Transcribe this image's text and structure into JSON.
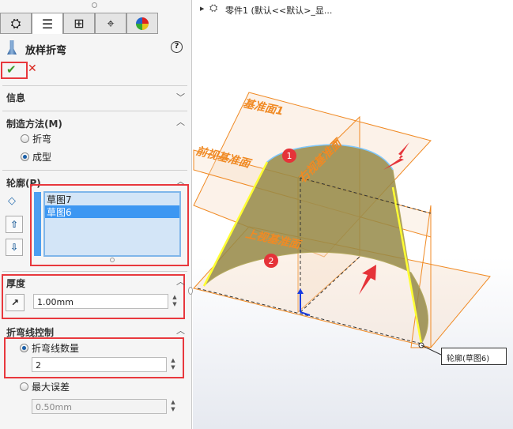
{
  "panel": {
    "tabs": [
      {
        "icon": "part-icon"
      },
      {
        "icon": "property-manager-icon"
      },
      {
        "icon": "config-manager-icon"
      },
      {
        "icon": "dimxpert-icon"
      },
      {
        "icon": "appearance-icon"
      }
    ],
    "title": "放样折弯",
    "help": "?",
    "ok": "✔",
    "cancel": "✕",
    "sections": {
      "info": "信息",
      "method": {
        "title": "制造方法(M)",
        "options": [
          "折弯",
          "成型"
        ],
        "selected": "成型"
      },
      "profile": {
        "title": "轮廓(P)",
        "items": [
          "草图7",
          "草图6"
        ],
        "selected": "草图6"
      },
      "thickness": {
        "title": "厚度",
        "value": "1.00mm"
      },
      "bendline": {
        "title": "折弯线控制",
        "option1": "折弯线数量",
        "count": "2",
        "option2": "最大误差",
        "tolerance": "0.50mm",
        "selected": "折弯线数量"
      }
    }
  },
  "viewport": {
    "tree_item": "零件1  (默认<<默认>_显...",
    "planes": [
      "基准面1",
      "前视基准面",
      "右视基准面",
      "上视基准面"
    ],
    "markers": [
      "1",
      "2"
    ],
    "callout": "轮廓(草图6)"
  }
}
